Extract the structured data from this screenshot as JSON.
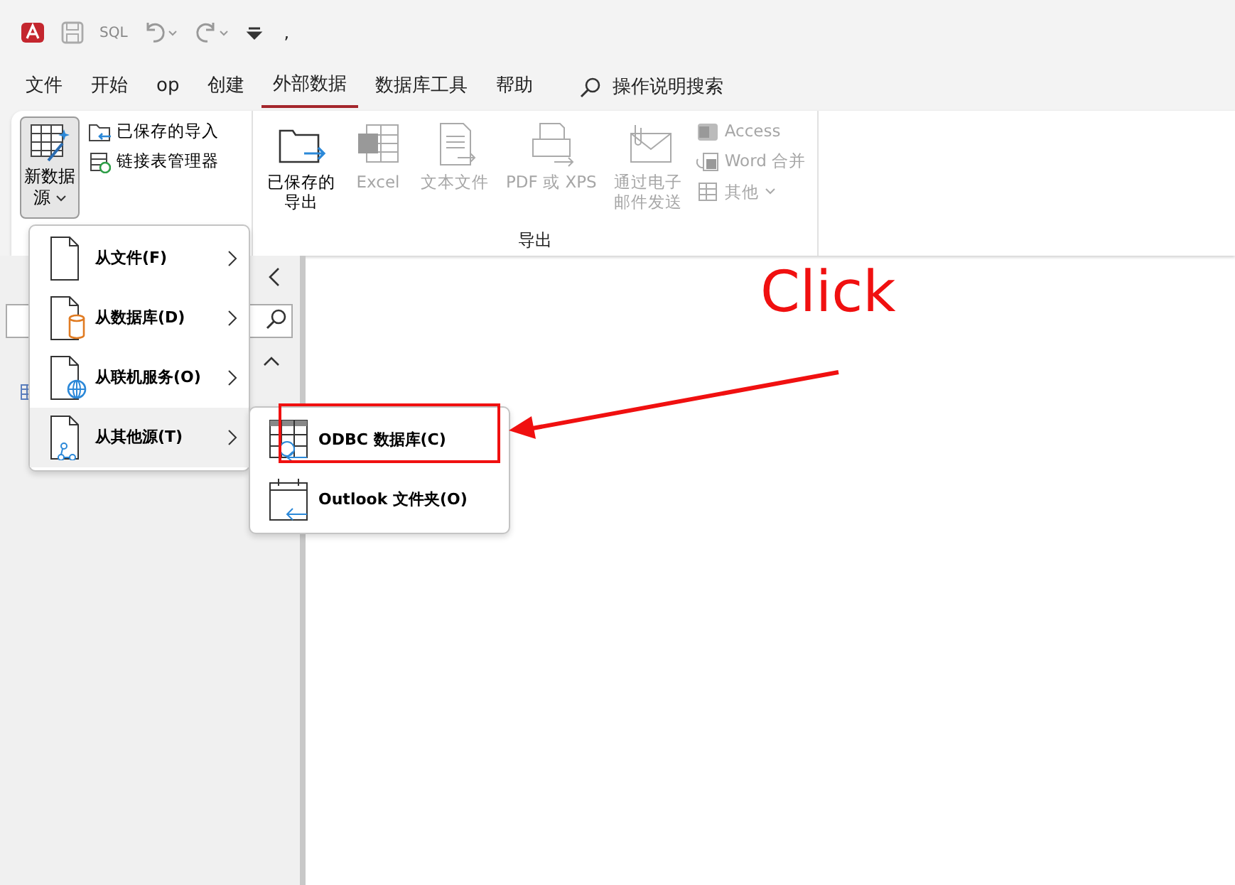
{
  "title_bar": {
    "sql_label": "SQL",
    "title": ","
  },
  "menu_tabs": [
    {
      "label": "文件",
      "selected": false
    },
    {
      "label": "开始",
      "selected": false
    },
    {
      "label": "op",
      "selected": false
    },
    {
      "label": "创建",
      "selected": false
    },
    {
      "label": "外部数据",
      "selected": true
    },
    {
      "label": "数据库工具",
      "selected": false
    },
    {
      "label": "帮助",
      "selected": false
    }
  ],
  "tell_me": {
    "label": "操作说明搜索"
  },
  "ribbon": {
    "import_group": {
      "new_source": {
        "label": "新数据源",
        "expanded": true
      },
      "small_buttons": [
        {
          "label": "已保存的导入",
          "kind": "saved-import"
        },
        {
          "label": "链接表管理器",
          "kind": "linked-table"
        }
      ]
    },
    "export_group": {
      "label": "导出",
      "big_buttons": [
        {
          "label": "已保存的导出",
          "kind": "saved-export",
          "disabled": false
        },
        {
          "label": "Excel",
          "kind": "excel",
          "disabled": true
        },
        {
          "label": "文本文件",
          "kind": "text-file",
          "disabled": true
        },
        {
          "label": "PDF 或 XPS",
          "kind": "pdf",
          "disabled": true
        },
        {
          "label": "通过电子邮件发送",
          "kind": "email",
          "disabled": true
        }
      ],
      "small_buttons": [
        {
          "label": "Access",
          "kind": "access",
          "disabled": true,
          "dropdown": false
        },
        {
          "label": "Word 合并",
          "kind": "word",
          "disabled": true,
          "dropdown": false
        },
        {
          "label": "其他",
          "kind": "other",
          "disabled": true,
          "dropdown": true
        }
      ]
    }
  },
  "dropdown": [
    {
      "label": "从文件(F)",
      "kind": "file",
      "selected": false
    },
    {
      "label": "从数据库(D)",
      "kind": "database",
      "selected": false
    },
    {
      "label": "从联机服务(O)",
      "kind": "online",
      "selected": false
    },
    {
      "label": "从其他源(T)",
      "kind": "other",
      "selected": true
    }
  ],
  "submenu": [
    {
      "label": "ODBC 数据库(C)",
      "kind": "odbc"
    },
    {
      "label": "Outlook 文件夹(O)",
      "kind": "outlook"
    }
  ],
  "annotation": {
    "label": "Click"
  }
}
